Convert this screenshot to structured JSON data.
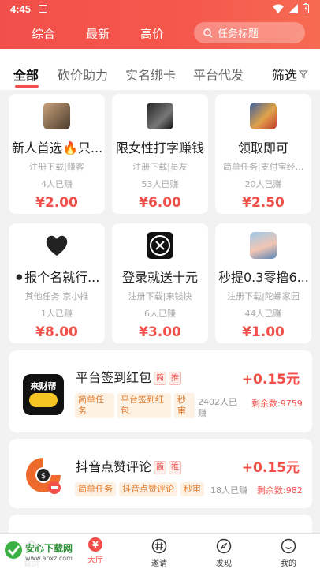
{
  "status": {
    "time": "4:45"
  },
  "topnav": {
    "items": [
      "综合",
      "最新",
      "高价"
    ],
    "search_placeholder": "任务标题"
  },
  "tabs": {
    "items": [
      "全部",
      "砍价助力",
      "实名绑卡",
      "平台代发"
    ],
    "filter": "筛选"
  },
  "cards": [
    {
      "title": "新人首选🔥只...",
      "sub": "注册下载|赚客",
      "count": "4人已赚",
      "price": "¥2.00"
    },
    {
      "title": "限女性打字赚钱",
      "sub": "注册下载|员友",
      "count": "53人已赚",
      "price": "¥6.00"
    },
    {
      "title": "领取即可",
      "sub": "简单任务|支付宝经...",
      "count": "20人已赚",
      "price": "¥2.50"
    },
    {
      "title": "⚫报个名就行...",
      "sub": "其他任务|京小推",
      "count": "1人已赚",
      "price": "¥8.00"
    },
    {
      "title": "登录就送十元",
      "sub": "注册下载|来钱快",
      "count": "6人已赚",
      "price": "¥3.00"
    },
    {
      "title": "秒提0.3零撸6...",
      "sub": "注册下载|陀螺家园",
      "count": "44人已赚",
      "price": "¥1.00"
    }
  ],
  "tasks": [
    {
      "title": "平台签到红包",
      "badges": [
        "简",
        "推"
      ],
      "price": "+0.15元",
      "tags": [
        "简单任务",
        "平台签到红包",
        "秒审"
      ],
      "count": "2402人已赚",
      "remain": "剩余数:9759",
      "icon_text": "来财帮"
    },
    {
      "title": "抖音点赞评论",
      "badges": [
        "简",
        "推"
      ],
      "price": "+0.15元",
      "tags": [
        "简单任务",
        "抖音点赞评论",
        "秒审"
      ],
      "count": "18人已赚",
      "remain": "剩余数:982"
    }
  ],
  "bottomnav": {
    "items": [
      "首页",
      "大厅",
      "邀请",
      "发现",
      "我的"
    ]
  },
  "watermark": {
    "name": "安心下载网",
    "url": "www.anxz.com"
  },
  "colors": {
    "accent": "#f24f4a",
    "tag": "#e07b2d"
  }
}
